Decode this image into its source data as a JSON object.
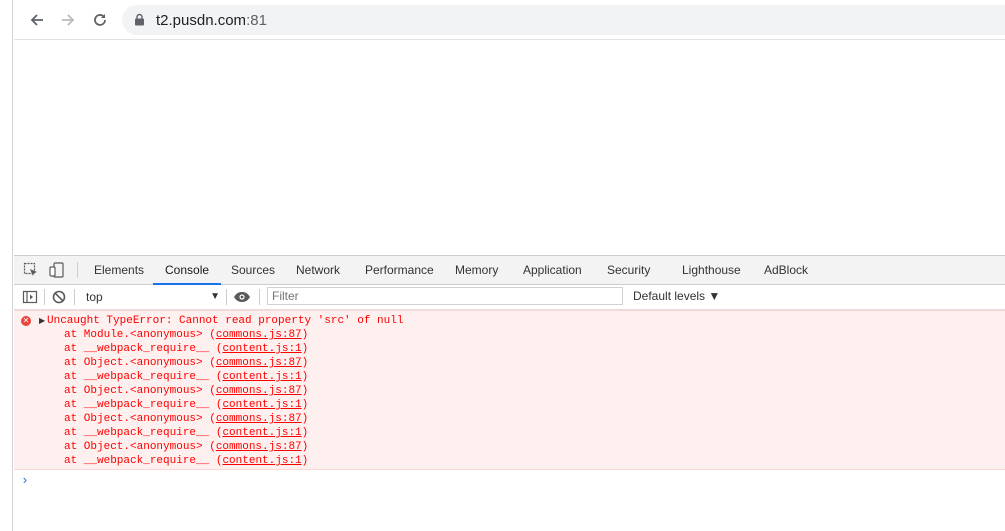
{
  "browser": {
    "url_host": "t2.pusdn.com",
    "url_port": ":81"
  },
  "devtools": {
    "tabs": [
      {
        "label": "Elements"
      },
      {
        "label": "Console"
      },
      {
        "label": "Sources"
      },
      {
        "label": "Network"
      },
      {
        "label": "Performance"
      },
      {
        "label": "Memory"
      },
      {
        "label": "Application"
      },
      {
        "label": "Security"
      },
      {
        "label": "Lighthouse"
      },
      {
        "label": "AdBlock"
      }
    ],
    "active_tab": "Console"
  },
  "console": {
    "context": "top",
    "filter_placeholder": "Filter",
    "levels": "Default levels ▼",
    "prompt_symbol": "›",
    "error": {
      "message": "Uncaught TypeError: Cannot read property 'src' of null",
      "stack": [
        {
          "prefix": "at Module.<anonymous> (",
          "src": "commons.js:87",
          "suffix": ")"
        },
        {
          "prefix": "at __webpack_require__ (",
          "src": "content.js:1",
          "suffix": ")"
        },
        {
          "prefix": "at Object.<anonymous> (",
          "src": "commons.js:87",
          "suffix": ")"
        },
        {
          "prefix": "at __webpack_require__ (",
          "src": "content.js:1",
          "suffix": ")"
        },
        {
          "prefix": "at Object.<anonymous> (",
          "src": "commons.js:87",
          "suffix": ")"
        },
        {
          "prefix": "at __webpack_require__ (",
          "src": "content.js:1",
          "suffix": ")"
        },
        {
          "prefix": "at Object.<anonymous> (",
          "src": "commons.js:87",
          "suffix": ")"
        },
        {
          "prefix": "at __webpack_require__ (",
          "src": "content.js:1",
          "suffix": ")"
        },
        {
          "prefix": "at Object.<anonymous> (",
          "src": "commons.js:87",
          "suffix": ")"
        },
        {
          "prefix": "at __webpack_require__ (",
          "src": "content.js:1",
          "suffix": ")"
        }
      ]
    }
  },
  "colors": {
    "accent": "#1a73e8",
    "error_text": "#ff0000",
    "error_bg": "#fff0f0"
  },
  "icons": {
    "back": "back-arrow-icon",
    "forward": "forward-arrow-icon",
    "reload": "reload-icon",
    "lock": "lock-icon",
    "inspect": "inspect-element-icon",
    "device": "device-toolbar-icon",
    "sidebar": "console-sidebar-icon",
    "clear": "clear-console-icon",
    "eye": "live-expression-eye-icon",
    "error": "error-icon"
  }
}
